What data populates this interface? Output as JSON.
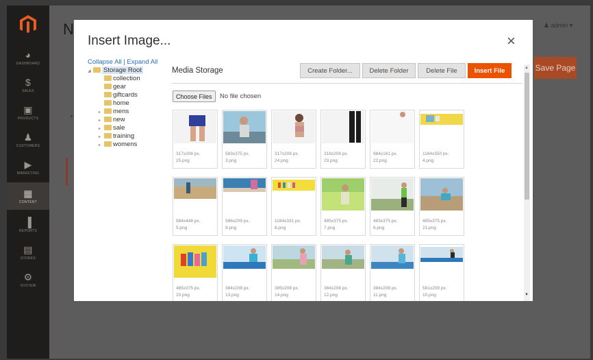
{
  "sidebar": {
    "items": [
      {
        "label": "DASHBOARD",
        "icon": "dashboard-icon"
      },
      {
        "label": "SALES",
        "icon": "dollar-icon"
      },
      {
        "label": "PRODUCTS",
        "icon": "box-icon"
      },
      {
        "label": "CUSTOMERS",
        "icon": "person-icon"
      },
      {
        "label": "MARKETING",
        "icon": "megaphone-icon"
      },
      {
        "label": "CONTENT",
        "icon": "content-icon"
      },
      {
        "label": "REPORTS",
        "icon": "bar-chart-icon"
      },
      {
        "label": "STORES",
        "icon": "store-icon"
      },
      {
        "label": "SYSTEM",
        "icon": "gear-icon"
      }
    ]
  },
  "background": {
    "page_title_letter": "N",
    "admin_label": "admin",
    "save_page_label": "Save Page",
    "accent_color": "#eb5202"
  },
  "modal": {
    "title": "Insert Image...",
    "close_label": "×",
    "collapse_all": "Collapse All",
    "separator": "|",
    "expand_all": "Expand All",
    "tree": {
      "root": "Storage Root",
      "folders": [
        "collection",
        "gear",
        "giftcards",
        "home",
        "mens",
        "new",
        "sale",
        "training",
        "womens"
      ]
    },
    "media_storage_label": "Media Storage",
    "buttons": {
      "create_folder": "Create Folder...",
      "delete_folder": "Delete Folder",
      "delete_file": "Delete File",
      "insert_file": "Insert File"
    },
    "choose_files_label": "Choose Files",
    "no_file_label": "No file chosen",
    "files": [
      {
        "dims": "317x208 px.",
        "name": "25.png"
      },
      {
        "dims": "583x375 px.",
        "name": "3.png"
      },
      {
        "dims": "317x208 px.",
        "name": "24.png"
      },
      {
        "dims": "316x208 px.",
        "name": "23.png"
      },
      {
        "dims": "984x161 px.",
        "name": "22.png"
      },
      {
        "dims": "1164x350 px.",
        "name": "4.png"
      },
      {
        "dims": "984x448 px.",
        "name": "5.png"
      },
      {
        "dims": "586x209 px.",
        "name": "9.png"
      },
      {
        "dims": "1184x331 px.",
        "name": "8.png"
      },
      {
        "dims": "485x375 px.",
        "name": "7.png"
      },
      {
        "dims": "483x375 px.",
        "name": "6.png"
      },
      {
        "dims": "485x375 px.",
        "name": "21.png"
      },
      {
        "dims": "485x375 px.",
        "name": "20.png"
      },
      {
        "dims": "384x208 px.",
        "name": "13.png"
      },
      {
        "dims": "385x208 px.",
        "name": "14.png"
      },
      {
        "dims": "384x208 px.",
        "name": "12.png"
      },
      {
        "dims": "384x208 px.",
        "name": "11.png"
      },
      {
        "dims": "581x209 px.",
        "name": "10.png"
      }
    ]
  }
}
